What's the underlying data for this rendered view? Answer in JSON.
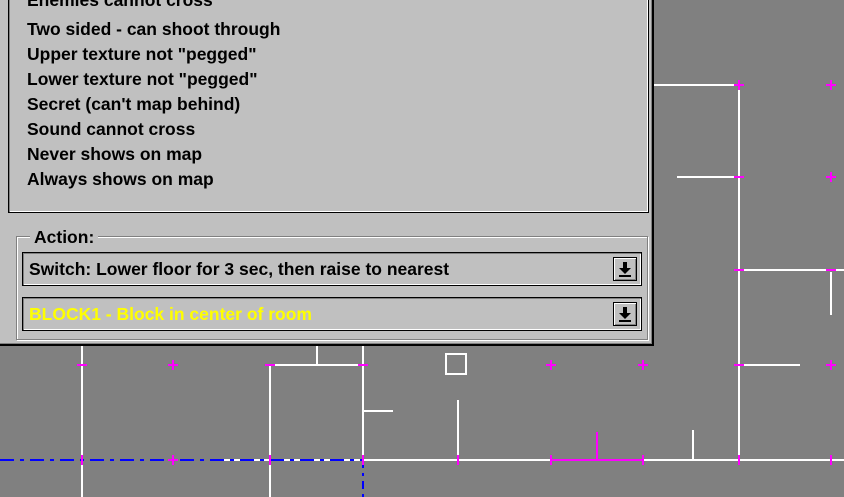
{
  "flags": {
    "items": [
      "Enemies cannot cross",
      "Two sided - can shoot through",
      "Upper texture not \"pegged\"",
      "Lower texture not \"pegged\"",
      "Secret (can't map behind)",
      "Sound cannot cross",
      "Never shows on map",
      "Always shows on map"
    ]
  },
  "action": {
    "legend": "Action:",
    "selected_action": "Switch: Lower floor for 3 sec, then raise to nearest",
    "selected_target": "BLOCK1 - Block in center of room"
  },
  "colors": {
    "panel_bg": "#c0c0c0",
    "map_bg": "#808080",
    "map_line": "#ffffff",
    "grid_marker": "#ff00ff",
    "blue_line": "#0000ff",
    "highlight_line": "#ff00ff",
    "target_text": "#ffff00"
  }
}
